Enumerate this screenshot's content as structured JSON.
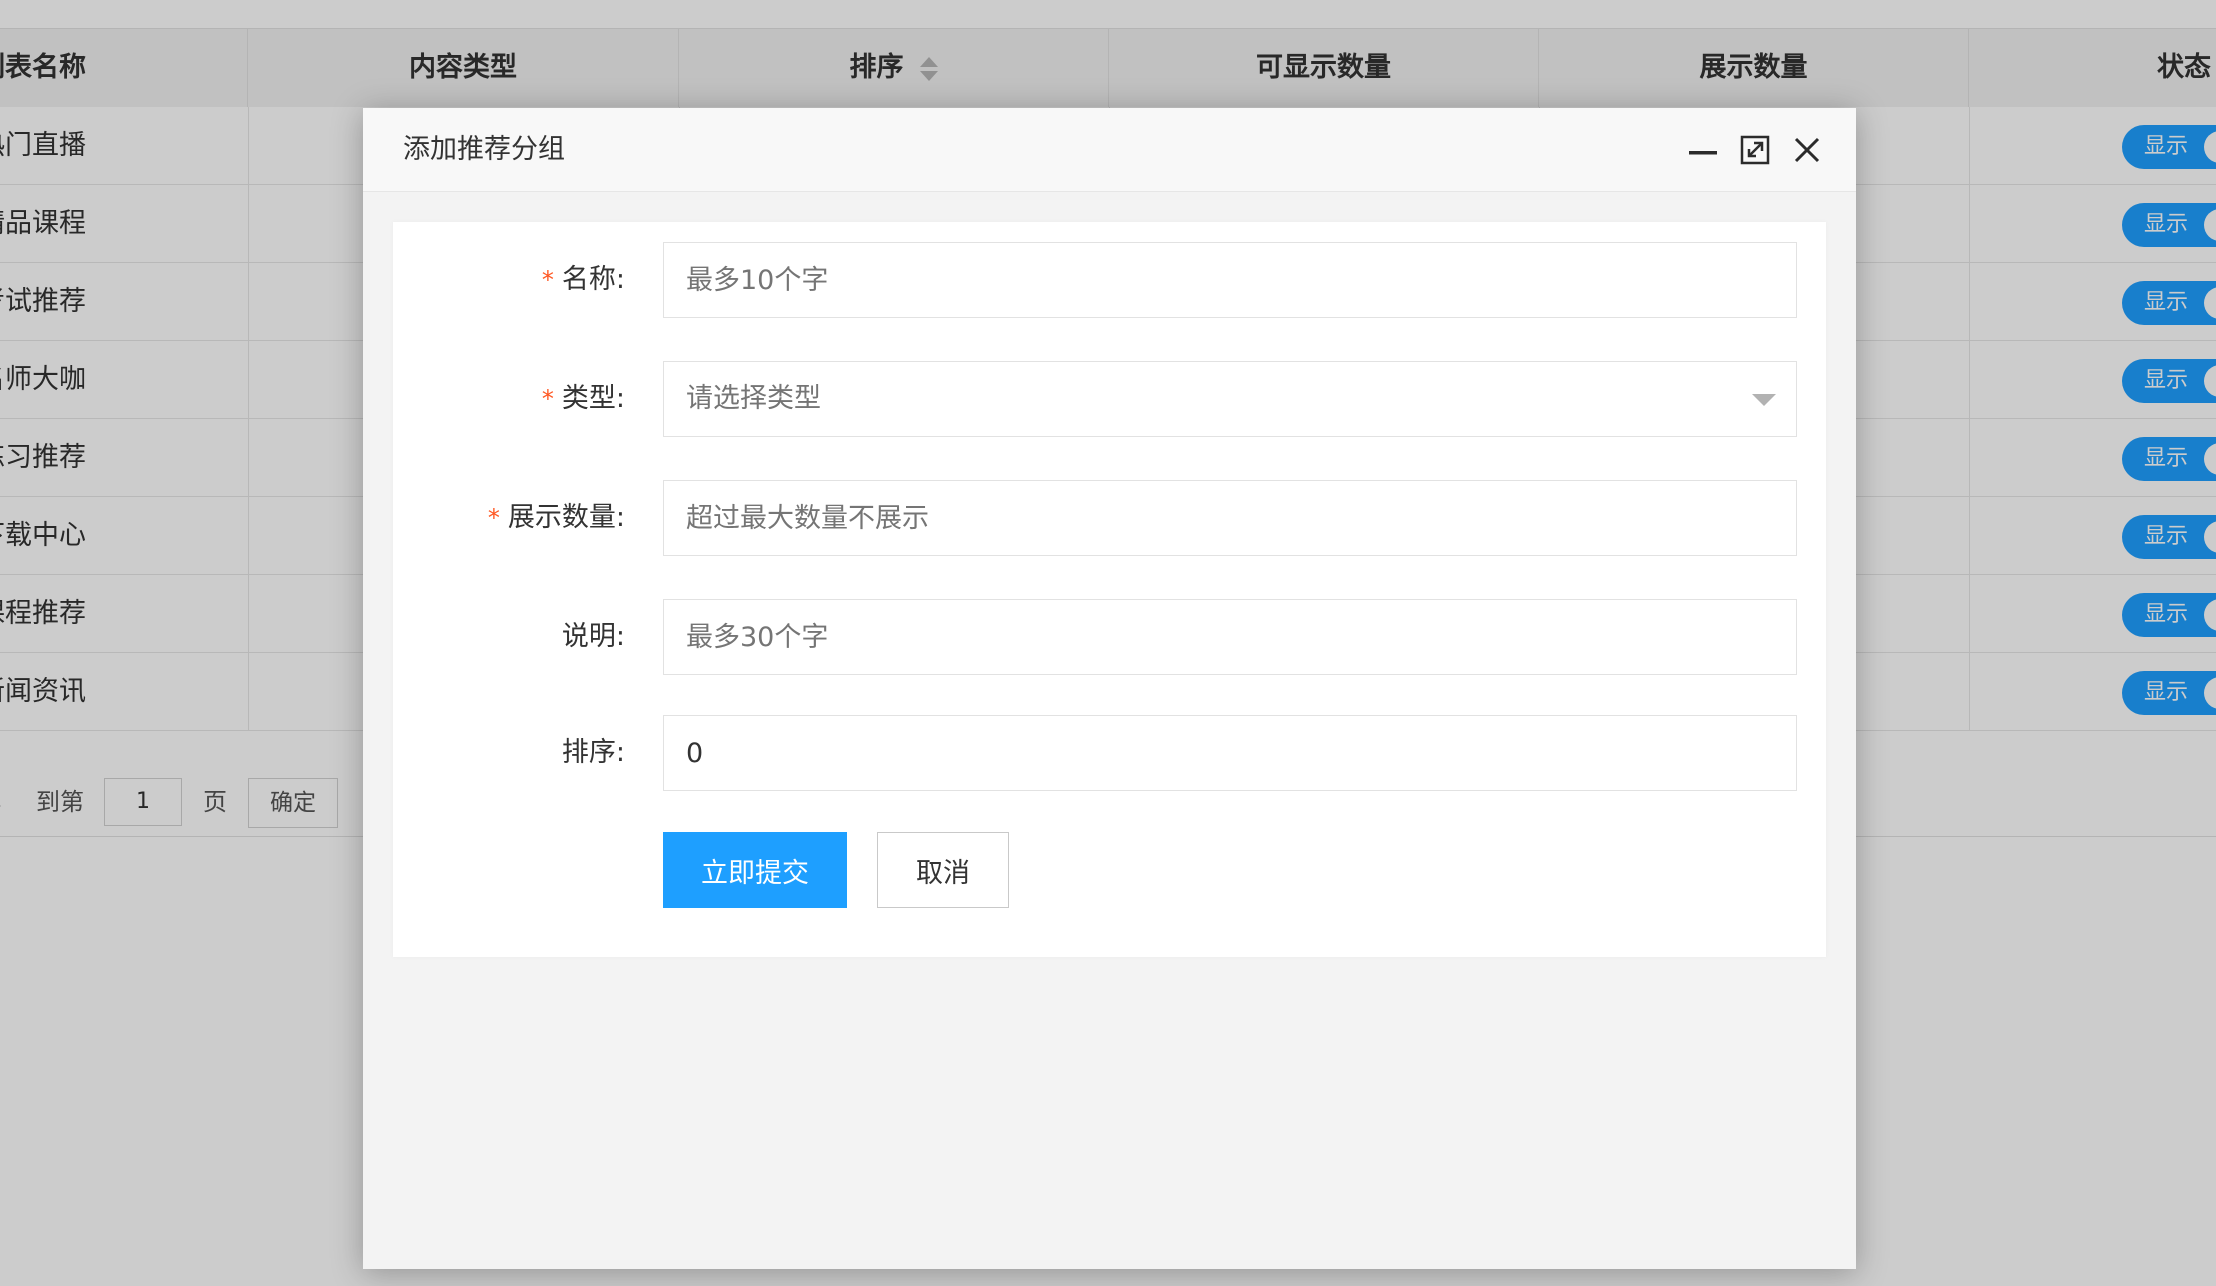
{
  "table": {
    "headers": {
      "name": "列表名称",
      "content_type": "内容类型",
      "sort": "排序",
      "max_count": "可显示数量",
      "show_count": "展示数量",
      "status": "状态"
    },
    "rows": [
      {
        "name": "热门直播",
        "status": "显示"
      },
      {
        "name": "精品课程",
        "status": "显示"
      },
      {
        "name": "考试推荐",
        "status": "显示"
      },
      {
        "name": "名师大咖",
        "status": "显示"
      },
      {
        "name": "练习推荐",
        "status": "显示"
      },
      {
        "name": "下载中心",
        "status": "显示"
      },
      {
        "name": "课程推荐",
        "status": "显示"
      },
      {
        "name": "新闻资讯",
        "status": "显示"
      }
    ]
  },
  "pager": {
    "goto_label": "到第",
    "page_value": "1",
    "page_unit": "页",
    "confirm_label": "确定"
  },
  "modal": {
    "title": "添加推荐分组",
    "fields": {
      "name": {
        "label": "名称:",
        "placeholder": "最多10个字"
      },
      "type": {
        "label": "类型:",
        "placeholder": "请选择类型"
      },
      "show_count": {
        "label": "展示数量:",
        "placeholder": "超过最大数量不展示"
      },
      "description": {
        "label": "说明:",
        "placeholder": "最多30个字"
      },
      "sort": {
        "label": "排序:",
        "value": "0"
      }
    },
    "required_mark": "*",
    "submit_label": "立即提交",
    "cancel_label": "取消"
  },
  "icons": {
    "minimize": "minimize-icon",
    "maximize": "maximize-icon",
    "close": "close-icon",
    "sort": "sort-icon",
    "dropdown": "chevron-down-icon"
  },
  "colors": {
    "primary": "#1e9fff",
    "required": "#ff5722"
  }
}
